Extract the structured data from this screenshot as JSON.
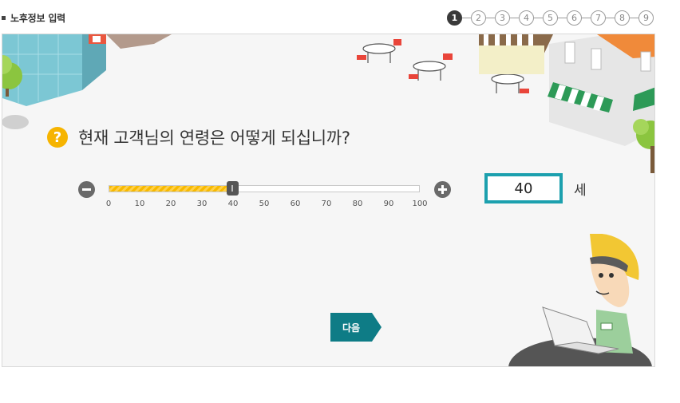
{
  "header": {
    "title": "노후정보 입력"
  },
  "steps": [
    {
      "label": "1",
      "active": true
    },
    {
      "label": "2"
    },
    {
      "label": "3"
    },
    {
      "label": "4"
    },
    {
      "label": "5"
    },
    {
      "label": "6"
    },
    {
      "label": "7"
    },
    {
      "label": "8"
    },
    {
      "label": "9"
    }
  ],
  "question": {
    "icon": "question-icon",
    "mark": "?",
    "text": "현재 고객님의 연령은 어떻게 되십니까?"
  },
  "slider": {
    "min": 0,
    "max": 100,
    "value": 40,
    "ticks": [
      "0",
      "10",
      "20",
      "30",
      "40",
      "50",
      "60",
      "70",
      "80",
      "90",
      "100"
    ],
    "decrease_icon": "minus-icon",
    "increase_icon": "plus-icon",
    "fill_color": "#f7b900"
  },
  "age": {
    "value": "40",
    "unit": "세",
    "border_color": "#1ca0ae"
  },
  "next_button": {
    "label": "다음",
    "color": "#0e7c86"
  }
}
